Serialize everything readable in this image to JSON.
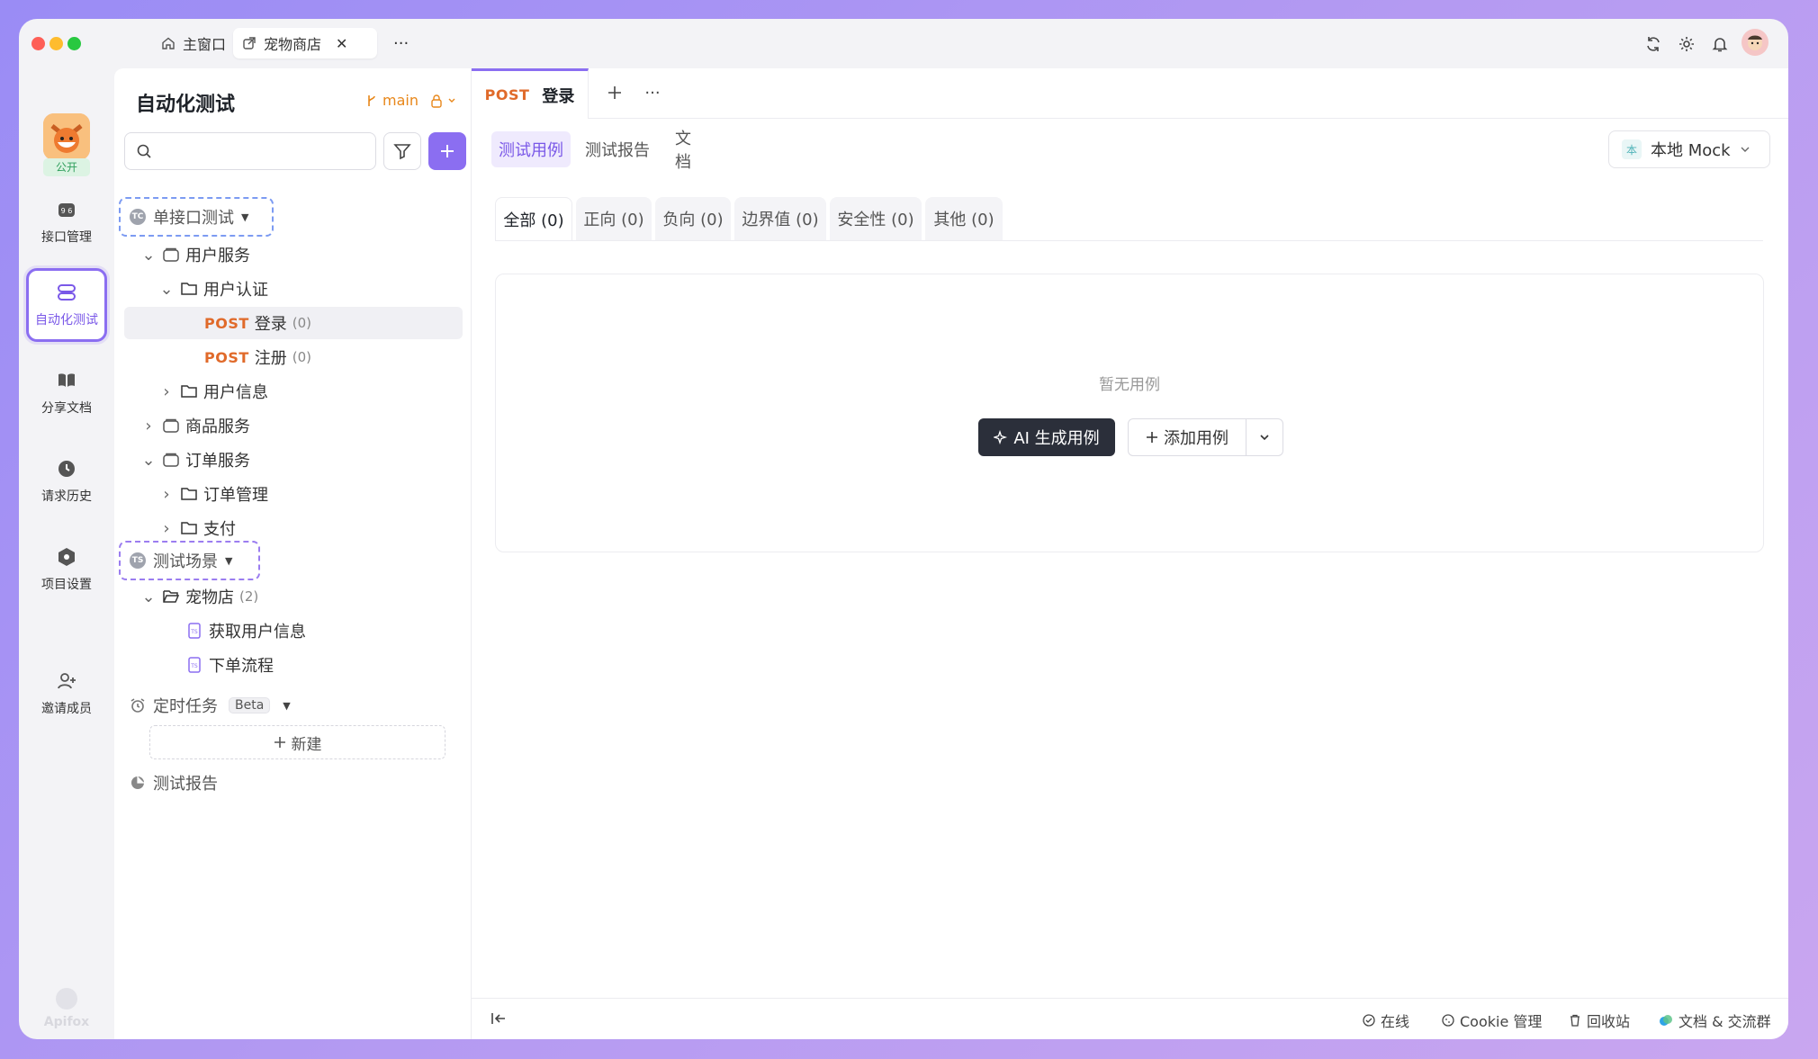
{
  "titlebar": {
    "home_tab": "主窗口",
    "active_tab": "宠物商店",
    "more": "···"
  },
  "leftnav": {
    "project_badge": "公开",
    "items": [
      {
        "label": "接口管理"
      },
      {
        "label": "自动化测试"
      },
      {
        "label": "分享文档"
      },
      {
        "label": "请求历史"
      },
      {
        "label": "项目设置"
      },
      {
        "label": "邀请成员"
      }
    ],
    "brand": "Apifox"
  },
  "sidebar": {
    "title": "自动化测试",
    "branch": "main",
    "search_placeholder": "",
    "groups": {
      "single": "单接口测试",
      "scenario": "测试场景",
      "scheduled": "定时任务",
      "beta": "Beta",
      "new": "新建",
      "report": "测试报告"
    },
    "tree": [
      {
        "label": "用户服务"
      },
      {
        "label": "用户认证"
      },
      {
        "method": "POST",
        "label": "登录",
        "count": "(0)"
      },
      {
        "method": "POST",
        "label": "注册",
        "count": "(0)"
      },
      {
        "label": "用户信息"
      },
      {
        "label": "商品服务"
      },
      {
        "label": "订单服务"
      },
      {
        "label": "订单管理"
      },
      {
        "label": "支付"
      },
      {
        "label": "宠物店",
        "count": "(2)"
      },
      {
        "label": "获取用户信息"
      },
      {
        "label": "下单流程"
      }
    ]
  },
  "main": {
    "tab_method": "POST",
    "tab_label": "登录",
    "subtabs": [
      "测试用例",
      "测试报告",
      "文档"
    ],
    "env": {
      "badge": "本",
      "label": "本地 Mock"
    },
    "filters": [
      "全部 (0)",
      "正向 (0)",
      "负向 (0)",
      "边界值 (0)",
      "安全性 (0)",
      "其他 (0)"
    ],
    "empty_text": "暂无用例",
    "ai_button": "AI 生成用例",
    "add_button": "添加用例"
  },
  "footer": {
    "online": "在线",
    "cookie": "Cookie 管理",
    "recycle": "回收站",
    "docs": "文档 & 交流群"
  },
  "colors": {
    "accent": "#8b6ef1",
    "method_post": "#e06a2a",
    "branch": "#e8871a"
  }
}
